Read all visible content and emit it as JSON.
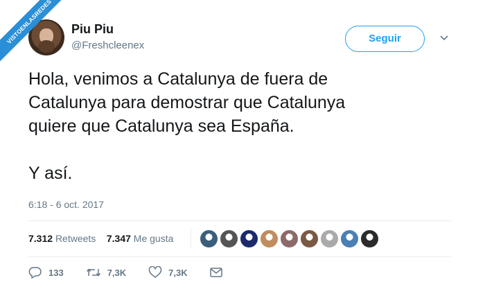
{
  "watermark": "VISTOENLASREDES",
  "tweet": {
    "author_name": "Piu Piu",
    "handle": "@Freshcleenex",
    "follow_label": "Seguir",
    "text": "Hola, venimos a Catalunya de fuera de\nCatalunya para demostrar que Catalunya\nquiere que Catalunya sea España.\n\nY así.",
    "timestamp": "6:18 - 6 oct. 2017"
  },
  "stats": {
    "retweets_count": "7.312",
    "retweets_label": "Retweets",
    "likes_count": "7.347",
    "likes_label": "Me gusta"
  },
  "actions": {
    "replies": "133",
    "retweets": "7,3K",
    "likes": "7,3K"
  },
  "likers": [
    "#3b5f7a",
    "#555555",
    "#1b2a6b",
    "#c08d5f",
    "#8c6a6a",
    "#7a5a45",
    "#aaaaaa",
    "#4a7fb5",
    "#2b2b2b"
  ],
  "colors": {
    "accent": "#1da1f2",
    "secondary_text": "#657786",
    "watermark": "#2a8fd6"
  },
  "icons": [
    "reply-icon",
    "retweet-icon",
    "heart-icon",
    "envelope-icon",
    "chevron-down-icon"
  ]
}
